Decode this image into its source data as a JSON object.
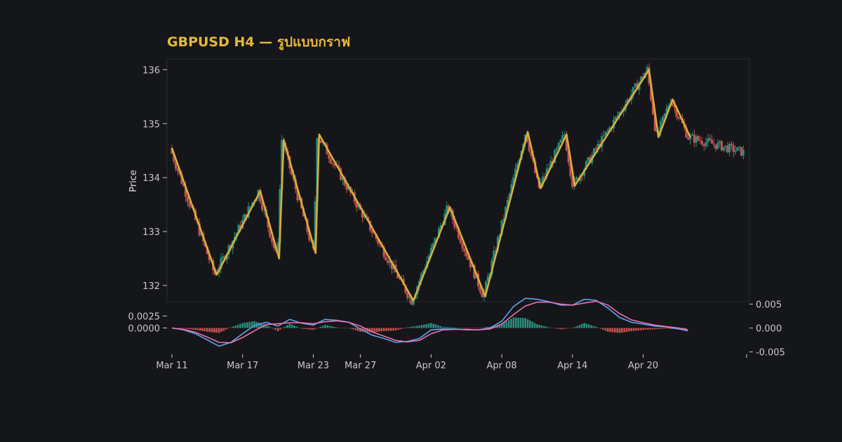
{
  "colors": {
    "background": "#151619",
    "panel_border": "#2a2c33",
    "title": "#e6b83c",
    "axis_text": "#c8c8cc",
    "up": "#2a8c7c",
    "down": "#c2524f",
    "zigzag": "#d9b13b",
    "macd_line": "#5aa6f0",
    "signal_line": "#ee6fb0"
  },
  "chart_data": {
    "type": "candlestick",
    "title": "GBPUSD H4 — รูปแบบกราฟ",
    "ylabel": "Price",
    "price_ylim": [
      131.7,
      136.2
    ],
    "price_yticks": [
      132,
      133,
      134,
      135,
      136
    ],
    "x_ticks": [
      "Mar 11",
      "Mar 17",
      "Mar 23",
      "Mar 27",
      "Apr 02",
      "Apr 08",
      "Apr 14",
      "Apr 20"
    ],
    "x_tick_days": [
      0,
      6,
      12,
      16,
      22,
      28,
      34,
      40
    ],
    "x_range_days": [
      0,
      48.6
    ],
    "zigzag": [
      [
        0.0,
        134.55
      ],
      [
        3.8,
        132.2
      ],
      [
        7.5,
        133.75
      ],
      [
        9.1,
        132.5
      ],
      [
        9.5,
        134.7
      ],
      [
        12.2,
        132.6
      ],
      [
        12.5,
        134.8
      ],
      [
        20.5,
        131.72
      ],
      [
        23.6,
        133.45
      ],
      [
        26.6,
        131.8
      ],
      [
        30.2,
        134.85
      ],
      [
        31.3,
        133.8
      ],
      [
        33.5,
        134.8
      ],
      [
        34.2,
        133.85
      ],
      [
        40.5,
        136.0
      ],
      [
        41.3,
        134.75
      ],
      [
        42.5,
        135.45
      ],
      [
        44.0,
        134.75
      ]
    ],
    "macd": {
      "ylim": [
        -0.0055,
        0.0055
      ],
      "left_ticks": [
        "0.0025",
        "0.0000"
      ],
      "left_tick_values": [
        0.0025,
        0.0
      ],
      "right_ticks": [
        "0.005",
        "0.000",
        "-0.005"
      ],
      "right_tick_values": [
        0.005,
        0.0,
        -0.005
      ],
      "macd_line": [
        [
          0,
          0.0
        ],
        [
          1,
          -0.0004
        ],
        [
          2,
          -0.0012
        ],
        [
          3,
          -0.0025
        ],
        [
          4,
          -0.0038
        ],
        [
          5,
          -0.003
        ],
        [
          6,
          -0.0012
        ],
        [
          7,
          0.0005
        ],
        [
          8,
          0.0012
        ],
        [
          9,
          0.0004
        ],
        [
          10,
          0.0018
        ],
        [
          11,
          0.001
        ],
        [
          12,
          0.0006
        ],
        [
          13,
          0.0018
        ],
        [
          14,
          0.0016
        ],
        [
          15,
          0.0012
        ],
        [
          16,
          -0.0002
        ],
        [
          17,
          -0.0015
        ],
        [
          18,
          -0.0022
        ],
        [
          19,
          -0.003
        ],
        [
          20,
          -0.0028
        ],
        [
          21,
          -0.0022
        ],
        [
          22,
          -0.0004
        ],
        [
          23,
          -0.0002
        ],
        [
          24,
          -0.0002
        ],
        [
          25,
          -0.0004
        ],
        [
          26,
          -0.0004
        ],
        [
          27,
          0.0
        ],
        [
          28,
          0.0014
        ],
        [
          29,
          0.0045
        ],
        [
          30,
          0.0062
        ],
        [
          31,
          0.006
        ],
        [
          32,
          0.0055
        ],
        [
          33,
          0.0048
        ],
        [
          34,
          0.0048
        ],
        [
          35,
          0.006
        ],
        [
          36,
          0.0058
        ],
        [
          37,
          0.0042
        ],
        [
          38,
          0.0022
        ],
        [
          39,
          0.0012
        ],
        [
          40,
          0.0008
        ],
        [
          41,
          0.0004
        ],
        [
          42,
          0.0002
        ],
        [
          43,
          -0.0002
        ],
        [
          43.8,
          -0.0006
        ]
      ],
      "signal_line": [
        [
          0,
          0.0
        ],
        [
          1,
          -0.0003
        ],
        [
          2,
          -0.0009
        ],
        [
          3,
          -0.0019
        ],
        [
          4,
          -0.003
        ],
        [
          5,
          -0.0031
        ],
        [
          6,
          -0.002
        ],
        [
          7,
          -0.0006
        ],
        [
          8,
          0.0007
        ],
        [
          9,
          0.0009
        ],
        [
          10,
          0.0011
        ],
        [
          11,
          0.0011
        ],
        [
          12,
          0.0009
        ],
        [
          13,
          0.0013
        ],
        [
          14,
          0.0015
        ],
        [
          15,
          0.0012
        ],
        [
          16,
          0.0004
        ],
        [
          17,
          -0.0008
        ],
        [
          18,
          -0.0017
        ],
        [
          19,
          -0.0026
        ],
        [
          20,
          -0.0029
        ],
        [
          21,
          -0.0026
        ],
        [
          22,
          -0.0012
        ],
        [
          23,
          -0.0004
        ],
        [
          24,
          -0.0003
        ],
        [
          25,
          -0.0003
        ],
        [
          26,
          -0.0004
        ],
        [
          27,
          -0.0002
        ],
        [
          28,
          0.0008
        ],
        [
          29,
          0.0028
        ],
        [
          30,
          0.0046
        ],
        [
          31,
          0.0054
        ],
        [
          32,
          0.0054
        ],
        [
          33,
          0.005
        ],
        [
          34,
          0.0048
        ],
        [
          35,
          0.0052
        ],
        [
          36,
          0.0056
        ],
        [
          37,
          0.0048
        ],
        [
          38,
          0.003
        ],
        [
          39,
          0.0017
        ],
        [
          40,
          0.0011
        ],
        [
          41,
          0.0006
        ],
        [
          42,
          0.0003
        ],
        [
          43,
          0.0
        ],
        [
          43.8,
          -0.0004
        ]
      ]
    }
  }
}
